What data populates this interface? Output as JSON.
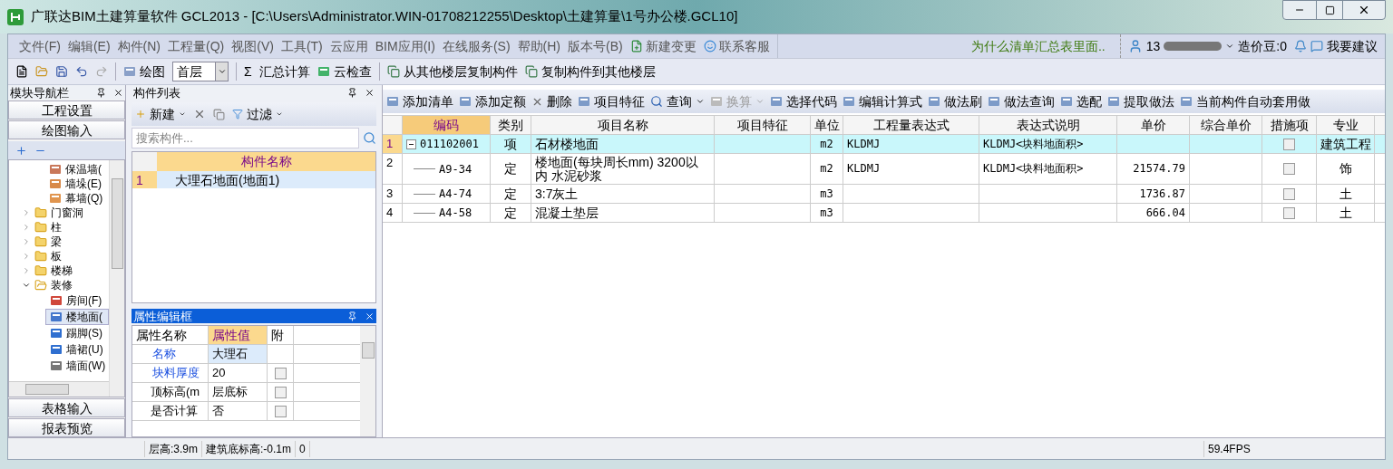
{
  "window": {
    "title": "广联达BIM土建算量软件 GCL2013 - [C:\\Users\\Administrator.WIN-01708212255\\Desktop\\土建算量\\1号办公楼.GCL10]"
  },
  "menu": [
    {
      "label": "文件(F)",
      "kind": "menu"
    },
    {
      "label": "编辑(E)",
      "kind": "menu"
    },
    {
      "label": "构件(N)",
      "kind": "menu"
    },
    {
      "label": "工程量(Q)",
      "kind": "menu"
    },
    {
      "label": "视图(V)",
      "kind": "menu"
    },
    {
      "label": "工具(T)",
      "kind": "menu"
    },
    {
      "label": "云应用",
      "kind": "menu"
    },
    {
      "label": "BIM应用(I)",
      "kind": "menu"
    },
    {
      "label": "在线服务(S)",
      "kind": "menu"
    },
    {
      "label": "帮助(H)",
      "kind": "menu"
    },
    {
      "label": "版本号(B)",
      "kind": "menu"
    },
    {
      "label": "新建变更",
      "kind": "change"
    },
    {
      "label": "联系客服",
      "kind": "service"
    }
  ],
  "notice": "为什么清单汇总表里面..",
  "user": {
    "account": "13",
    "beans": "造价豆:0",
    "suggest": "我要建议"
  },
  "toolbar": {
    "draw": "绘图",
    "floor": "首层",
    "sum_icon": "Σ",
    "sum": "汇总计算",
    "cloud_check": "云检查",
    "copy_from": "从其他楼层复制构件",
    "copy_to": "复制构件到其他楼层"
  },
  "nav": {
    "title": "模块导航栏",
    "sections_top": [
      "工程设置",
      "绘图输入"
    ],
    "tree": {
      "hidden_parent_children": [
        {
          "label": "保温墙("
        },
        {
          "label": "墙垛(E)"
        },
        {
          "label": "幕墙(Q)"
        }
      ],
      "items": [
        {
          "label": "门窗洞",
          "expanded": false
        },
        {
          "label": "柱",
          "expanded": false
        },
        {
          "label": "梁",
          "expanded": false
        },
        {
          "label": "板",
          "expanded": false
        },
        {
          "label": "楼梯",
          "expanded": false
        },
        {
          "label": "装修",
          "expanded": true,
          "children": [
            {
              "label": "房间(F)",
              "selected": false
            },
            {
              "label": "楼地面(",
              "selected": true
            },
            {
              "label": "踢脚(S)",
              "selected": false
            },
            {
              "label": "墙裙(U)",
              "selected": false
            },
            {
              "label": "墙面(W)",
              "selected": false
            }
          ]
        }
      ]
    },
    "sections_bottom": [
      "表格输入",
      "报表预览"
    ]
  },
  "components": {
    "title": "构件列表",
    "new": "新建",
    "filter": "过滤",
    "search_placeholder": "搜索构件...",
    "column": "构件名称",
    "rows": [
      {
        "num": "1",
        "name": "大理石地面(地面1)",
        "selected": true
      }
    ]
  },
  "properties": {
    "title": "属性编辑框",
    "columns": [
      "属性名称",
      "属性值",
      "附"
    ],
    "rows": [
      {
        "name": "名称",
        "value": "大理石",
        "public": true
      },
      {
        "name": "块料厚度",
        "value": "20",
        "public": true,
        "checked": false
      },
      {
        "name": "顶标高(m",
        "value": "层底标",
        "public": false,
        "checked": false
      },
      {
        "name": "是否计算",
        "value": "否",
        "public": false,
        "checked": false
      }
    ]
  },
  "grid_toolbar": [
    {
      "label": "添加清单",
      "disabled": false,
      "dropdown": false
    },
    {
      "label": "添加定额",
      "disabled": false,
      "dropdown": false
    },
    {
      "label": "删除",
      "disabled": false,
      "dropdown": false
    },
    {
      "label": "项目特征",
      "disabled": false,
      "dropdown": false
    },
    {
      "label": "查询",
      "disabled": false,
      "dropdown": true
    },
    {
      "label": "换算",
      "disabled": true,
      "dropdown": true
    },
    {
      "label": "选择代码",
      "disabled": false,
      "dropdown": false
    },
    {
      "label": "编辑计算式",
      "disabled": false,
      "dropdown": false
    },
    {
      "label": "做法刷",
      "disabled": false,
      "dropdown": false
    },
    {
      "label": "做法查询",
      "disabled": false,
      "dropdown": false
    },
    {
      "label": "选配",
      "disabled": false,
      "dropdown": false
    },
    {
      "label": "提取做法",
      "disabled": false,
      "dropdown": false
    },
    {
      "label": "当前构件自动套用做",
      "disabled": false,
      "dropdown": false
    }
  ],
  "table": {
    "columns": [
      "编码",
      "类别",
      "项目名称",
      "项目特征",
      "单位",
      "工程量表达式",
      "表达式说明",
      "单价",
      "综合单价",
      "措施项",
      "专业"
    ],
    "rows": [
      {
        "num": "1",
        "code": "011102001",
        "type": "项",
        "kind": "list",
        "name": "石材楼地面",
        "feature": "",
        "unit": "m2",
        "expr": "KLDMJ",
        "expr_desc": "KLDMJ<块料地面积>",
        "price": "",
        "comp_price": "",
        "measure": false,
        "major": "建筑工程",
        "selected": true
      },
      {
        "num": "2",
        "code": "A9-34",
        "type": "定",
        "kind": "quota",
        "name": "楼地面(每块周长mm) 3200以内 水泥砂浆",
        "feature": "",
        "unit": "m2",
        "expr": "KLDMJ",
        "expr_desc": "KLDMJ<块料地面积>",
        "price": "21574.79",
        "comp_price": "",
        "measure": false,
        "major": "饰",
        "selected": false
      },
      {
        "num": "3",
        "code": "A4-74",
        "type": "定",
        "kind": "quota",
        "name": "3:7灰土",
        "feature": "",
        "unit": "m3",
        "expr": "",
        "expr_desc": "",
        "price": "1736.87",
        "comp_price": "",
        "measure": false,
        "major": "土",
        "selected": false
      },
      {
        "num": "4",
        "code": "A4-58",
        "type": "定",
        "kind": "quota",
        "name": "混凝土垫层",
        "feature": "",
        "unit": "m3",
        "expr": "",
        "expr_desc": "",
        "price": "666.04",
        "comp_price": "",
        "measure": false,
        "major": "土",
        "selected": false
      }
    ]
  },
  "status_bar": {
    "floor_height": "层高:3.9m",
    "base_elevation": "建筑底标高:-0.1m",
    "value": "0",
    "fps": "59.4FPS"
  }
}
